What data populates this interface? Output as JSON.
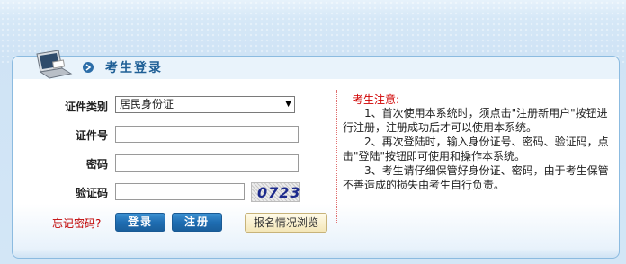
{
  "header": {
    "title": "考生登录"
  },
  "form": {
    "id_type_label": "证件类别",
    "id_type_value": "居民身份证",
    "id_number_label": "证件号",
    "password_label": "密码",
    "captcha_label": "验证码",
    "captcha_text": "0723"
  },
  "actions": {
    "forgot_password": "忘记密码?",
    "login": "登录",
    "register": "注册",
    "browse": "报名情况浏览"
  },
  "notice": {
    "title": "考生注意:",
    "items": [
      "1、首次使用本系统时，须点击\"注册新用户\"按钮进行注册，注册成功后才可以使用本系统。",
      "2、再次登陆时，输入身份证号、密码、验证码，点击\"登陆\"按钮即可使用和操作本系统。",
      "3、考生请仔细保管好身份证、密码，由于考生保管不善造成的损失由考生自行负责。"
    ]
  },
  "colors": {
    "accent": "#1f5f96",
    "notice_title": "#d00000",
    "forgot": "#c00000",
    "button": "#1f6db2"
  }
}
